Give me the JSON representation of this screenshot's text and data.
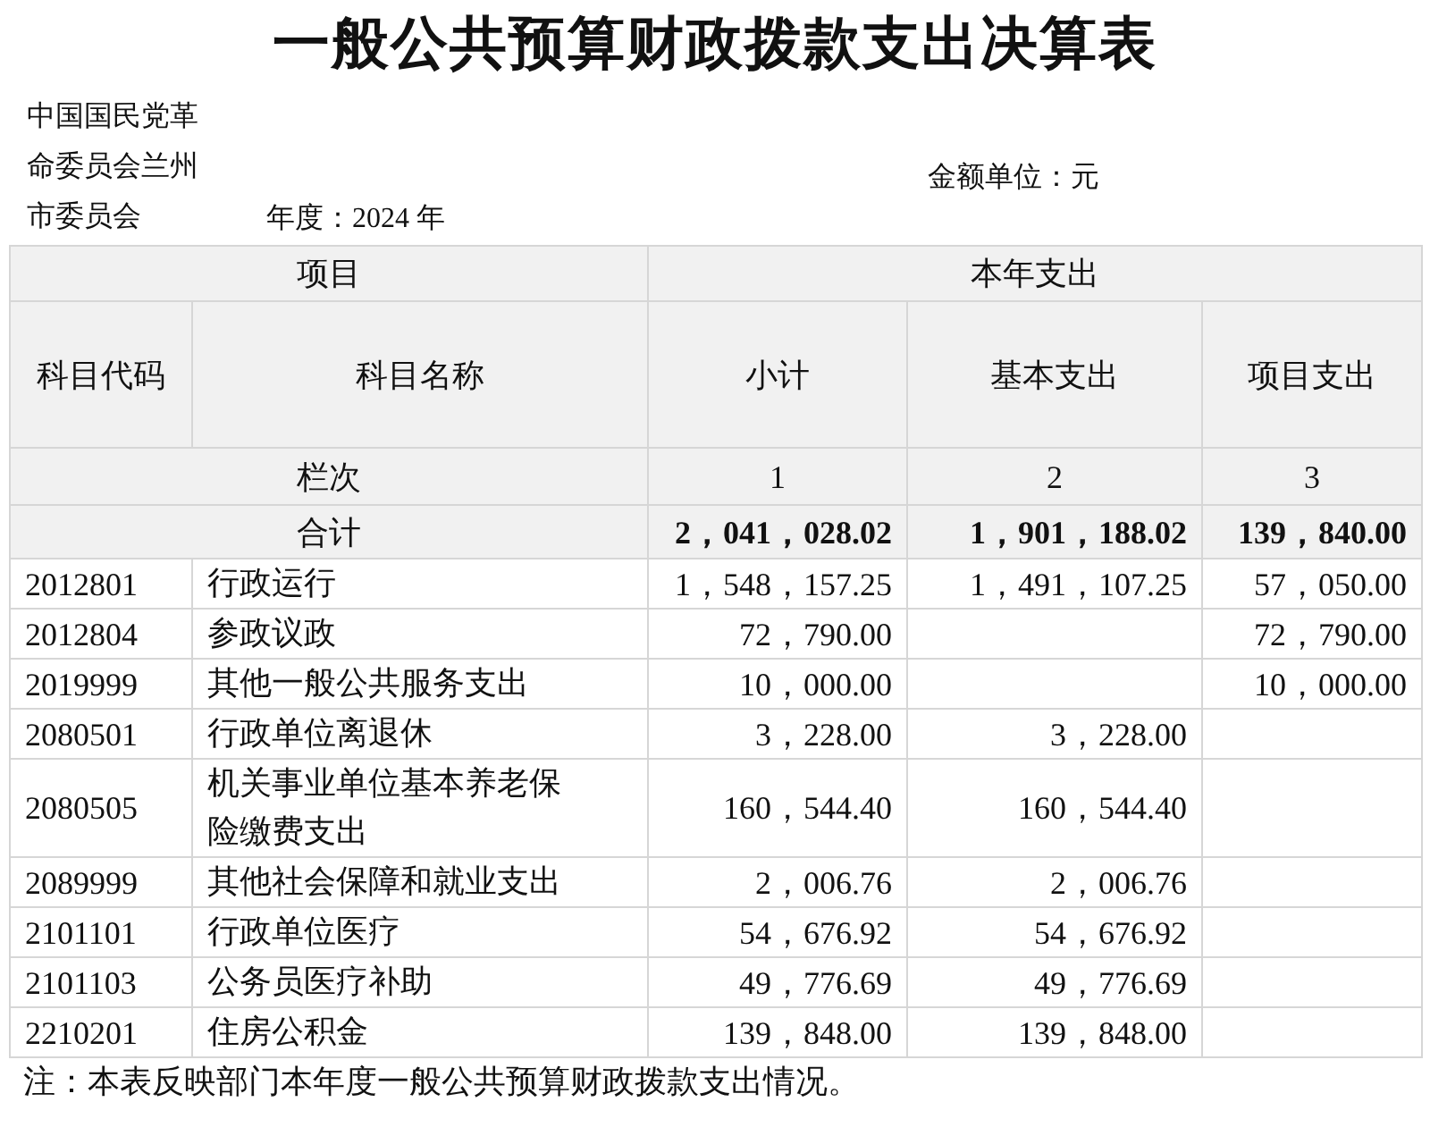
{
  "title": "一般公共预算财政拨款支出决算表",
  "unit_name": "中国国民党革命委员会兰州市委员会",
  "year_label": "年度：2024 年",
  "amount_unit": "金额单位：元",
  "table": {
    "group_headers": [
      "项目",
      "本年支出"
    ],
    "columns": [
      "科目代码",
      "科目名称",
      "小计",
      "基本支出",
      "项目支出"
    ],
    "column_numbers": {
      "label": "栏次",
      "values": [
        "1",
        "2",
        "3"
      ]
    },
    "total": {
      "label": "合计",
      "subtotal": "2，041，028.02",
      "basic": "1，901，188.02",
      "project": "139，840.00"
    },
    "rows": [
      {
        "code": "2012801",
        "name": "行政运行",
        "subtotal": "1，548，157.25",
        "basic": "1，491，107.25",
        "project": "57，050.00"
      },
      {
        "code": "2012804",
        "name": "参政议政",
        "subtotal": "72，790.00",
        "project": "72，790.00"
      },
      {
        "code": "2019999",
        "name": "其他一般公共服务支出",
        "subtotal": "10，000.00",
        "project": "10，000.00"
      },
      {
        "code": "2080501",
        "name": "行政单位离退休",
        "subtotal": "3，228.00",
        "basic": "3，228.00"
      },
      {
        "code": "2080505",
        "name": "机关事业单位基本养老保险缴费支出",
        "subtotal": "160，544.40",
        "basic": "160，544.40"
      },
      {
        "code": "2089999",
        "name": "其他社会保障和就业支出",
        "subtotal": "2，006.76",
        "basic": "2，006.76"
      },
      {
        "code": "2101101",
        "name": "行政单位医疗",
        "subtotal": "54，676.92",
        "basic": "54，676.92"
      },
      {
        "code": "2101103",
        "name": "公务员医疗补助",
        "subtotal": "49，776.69",
        "basic": "49，776.69"
      },
      {
        "code": "2210201",
        "name": "住房公积金",
        "subtotal": "139，848.00",
        "basic": "139，848.00"
      }
    ]
  },
  "note": "注：本表反映部门本年度一般公共预算财政拨款支出情况。"
}
